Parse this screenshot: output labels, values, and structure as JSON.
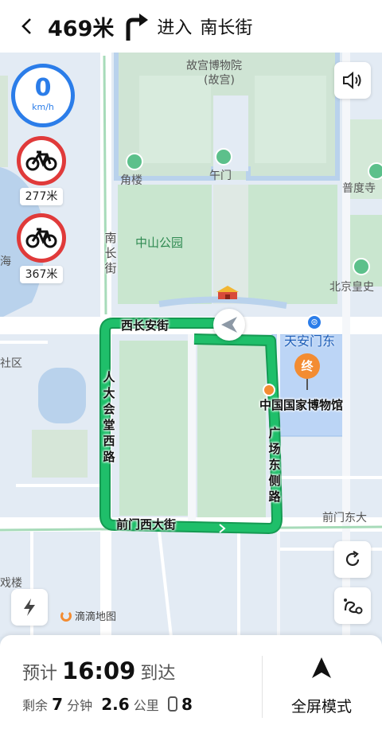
{
  "nav": {
    "distance": "469米",
    "turn_icon": "turn-right-icon",
    "action": "进入",
    "street": "南长街"
  },
  "speed": {
    "value": "0",
    "unit": "km/h"
  },
  "warnings": [
    {
      "icon": "bicycle-icon",
      "distance": "277米"
    },
    {
      "icon": "bicycle-icon",
      "distance": "367米"
    }
  ],
  "map": {
    "places": {
      "palace_museum": "故宫博物院",
      "palace_museum_sub": "(故宫)",
      "jiaolou": "角楼",
      "wumen": "午门",
      "putuo": "普度寺",
      "zhongshan_park": "中山公园",
      "beijing_huangshi": "北京皇史",
      "tiananmen_east": "天安门东",
      "national_museum": "中国国家博物馆",
      "qianmen_east": "前门东大",
      "district": "社区",
      "hai": "海",
      "xilou": "戏楼",
      "end_marker": "终"
    },
    "roads": {
      "nanchang": "南长街",
      "xichangan": "西长安街",
      "renda": "人大会堂西路",
      "guangchang": "广场东侧路",
      "qianmen_west": "前门西大街"
    },
    "brand": "滴滴地图",
    "colors": {
      "route": "#1fbf6a",
      "route_border": "#159a52",
      "water": "#b9d2ec",
      "green": "#c9e6cf",
      "accent": "#2b7de9"
    }
  },
  "bottom": {
    "eta_prefix": "预计",
    "eta_time": "16:09",
    "eta_suffix": "到达",
    "remain_prefix": "剩余",
    "remain_minutes": "7",
    "minutes_unit": "分钟",
    "remain_km": "2.6",
    "km_unit": "公里",
    "lights": "8",
    "fullscreen": "全屏模式"
  }
}
